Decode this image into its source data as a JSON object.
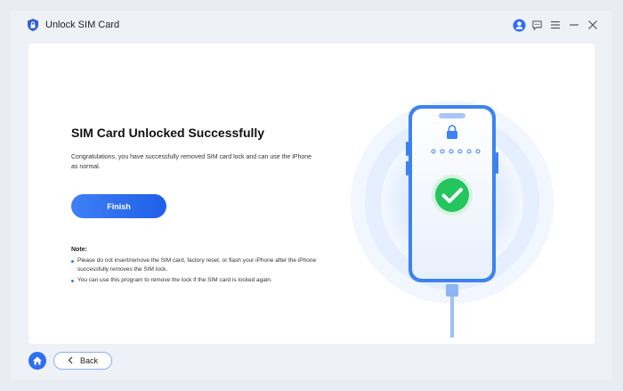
{
  "app": {
    "title": "Unlock SIM Card",
    "logo_icon": "shield-lock-icon"
  },
  "titlebar_icons": [
    "user-account-icon",
    "feedback-icon",
    "menu-icon",
    "minimize-icon",
    "close-icon"
  ],
  "main": {
    "heading": "SIM Card Unlocked Successfully",
    "description": "Congratulations, you have successfully removed SIM card lock and can use the iPhone as normal.",
    "finish_label": "Finish",
    "note_title": "Note:",
    "notes": [
      "Please do not insert/remove the SIM card, factory reset, or flash your iPhone after the iPhone successfully removes the SIM lock.",
      "You can use this program to remove the lock if the SIM card is locked again."
    ]
  },
  "illustration": {
    "phone_icon": "phone-icon",
    "lock_icon": "lock-icon",
    "success_icon": "check-circle-icon",
    "passcode_dots": 6
  },
  "footer": {
    "home_icon": "home-icon",
    "back_label": "Back"
  },
  "colors": {
    "accent": "#2f6ef0",
    "success": "#22c55e",
    "background": "#eef1f6"
  }
}
